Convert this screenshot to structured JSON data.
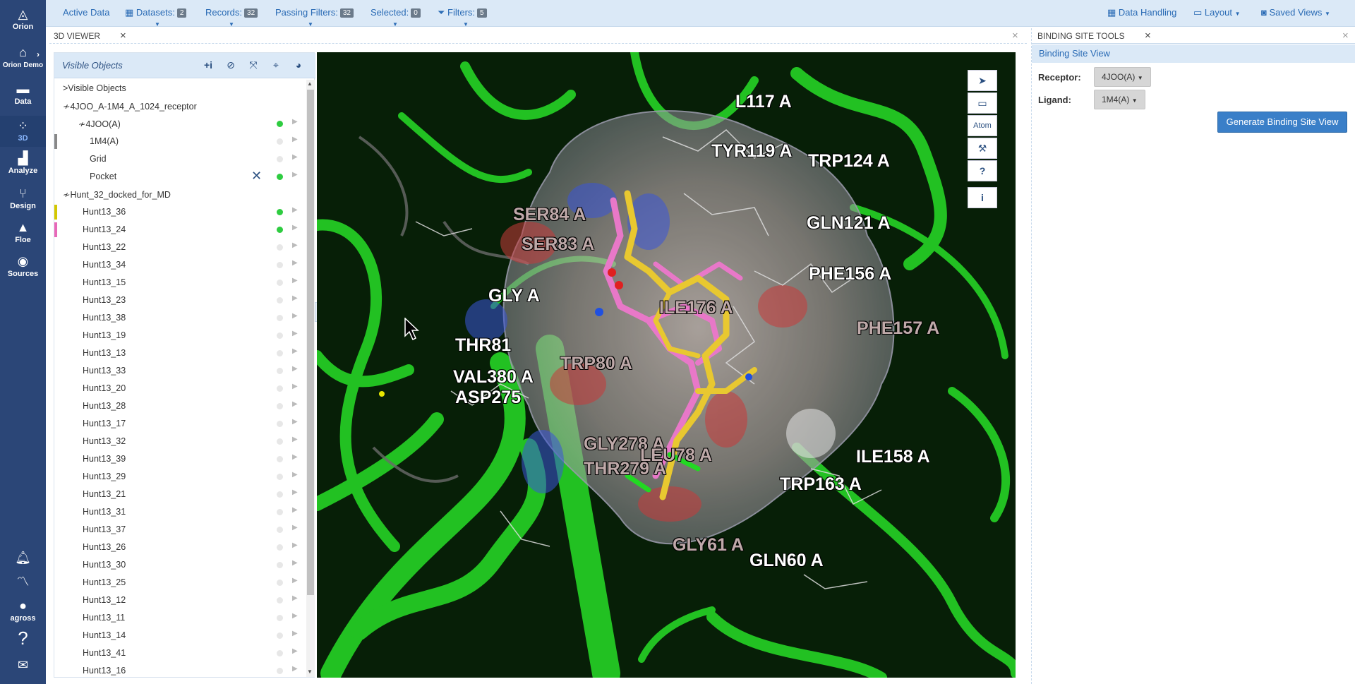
{
  "nav": {
    "brand": "Orion",
    "items": [
      {
        "label": "Orion Demo",
        "icon": "home-icon"
      },
      {
        "label": "Data",
        "icon": "folder-icon"
      },
      {
        "label": "3D",
        "icon": "molecule-icon"
      },
      {
        "label": "Analyze",
        "icon": "bar-chart-icon"
      },
      {
        "label": "Design",
        "icon": "flow-icon"
      },
      {
        "label": "Floe",
        "icon": "rocket-icon"
      },
      {
        "label": "Sources",
        "icon": "database-icon"
      }
    ],
    "user": "agross"
  },
  "topbar": {
    "active_data": "Active Data",
    "datasets": {
      "label": "Datasets:",
      "count": "2"
    },
    "records": {
      "label": "Records:",
      "count": "32"
    },
    "passing_filters": {
      "label": "Passing Filters:",
      "count": "32"
    },
    "selected": {
      "label": "Selected:",
      "count": "0"
    },
    "filters": {
      "label": "Filters:",
      "count": "5"
    },
    "data_handling": "Data Handling",
    "layout": "Layout",
    "saved_views": "Saved Views"
  },
  "viewer": {
    "tab_title": "3D VIEWER",
    "tree_title": "Visible Objects",
    "rows": [
      {
        "label": ">Visible Objects",
        "indent": 0,
        "dot": "",
        "color": ""
      },
      {
        "label": "≁4JOO_A-1M4_A_1024_receptor",
        "indent": 0,
        "dot": "",
        "color": ""
      },
      {
        "label": "≁4JOO(A)",
        "indent": 1,
        "dot": "on",
        "color": ""
      },
      {
        "label": "1M4(A)",
        "indent": 2,
        "dot": "off",
        "color": "#888888"
      },
      {
        "label": "Grid",
        "indent": 2,
        "dot": "off",
        "color": ""
      },
      {
        "label": "Pocket",
        "indent": 2,
        "dot": "on",
        "color": "",
        "x": true
      },
      {
        "label": "≁Hunt_32_docked_for_MD",
        "indent": 0,
        "dot": "",
        "color": ""
      },
      {
        "label": "Hunt13_36",
        "indent": 1,
        "dot": "on",
        "color": "#d4c800"
      },
      {
        "label": "Hunt13_24",
        "indent": 1,
        "dot": "on",
        "color": "#e868b8"
      },
      {
        "label": "Hunt13_22",
        "indent": 1,
        "dot": "off",
        "color": ""
      },
      {
        "label": "Hunt13_34",
        "indent": 1,
        "dot": "off",
        "color": ""
      },
      {
        "label": "Hunt13_15",
        "indent": 1,
        "dot": "off",
        "color": ""
      },
      {
        "label": "Hunt13_23",
        "indent": 1,
        "dot": "off",
        "color": ""
      },
      {
        "label": "Hunt13_38",
        "indent": 1,
        "dot": "off",
        "color": ""
      },
      {
        "label": "Hunt13_19",
        "indent": 1,
        "dot": "off",
        "color": ""
      },
      {
        "label": "Hunt13_13",
        "indent": 1,
        "dot": "off",
        "color": ""
      },
      {
        "label": "Hunt13_33",
        "indent": 1,
        "dot": "off",
        "color": ""
      },
      {
        "label": "Hunt13_20",
        "indent": 1,
        "dot": "off",
        "color": ""
      },
      {
        "label": "Hunt13_28",
        "indent": 1,
        "dot": "off",
        "color": ""
      },
      {
        "label": "Hunt13_17",
        "indent": 1,
        "dot": "off",
        "color": ""
      },
      {
        "label": "Hunt13_32",
        "indent": 1,
        "dot": "off",
        "color": ""
      },
      {
        "label": "Hunt13_39",
        "indent": 1,
        "dot": "off",
        "color": ""
      },
      {
        "label": "Hunt13_29",
        "indent": 1,
        "dot": "off",
        "color": ""
      },
      {
        "label": "Hunt13_21",
        "indent": 1,
        "dot": "off",
        "color": ""
      },
      {
        "label": "Hunt13_31",
        "indent": 1,
        "dot": "off",
        "color": ""
      },
      {
        "label": "Hunt13_37",
        "indent": 1,
        "dot": "off",
        "color": ""
      },
      {
        "label": "Hunt13_26",
        "indent": 1,
        "dot": "off",
        "color": ""
      },
      {
        "label": "Hunt13_30",
        "indent": 1,
        "dot": "off",
        "color": ""
      },
      {
        "label": "Hunt13_25",
        "indent": 1,
        "dot": "off",
        "color": ""
      },
      {
        "label": "Hunt13_12",
        "indent": 1,
        "dot": "off",
        "color": ""
      },
      {
        "label": "Hunt13_11",
        "indent": 1,
        "dot": "off",
        "color": ""
      },
      {
        "label": "Hunt13_14",
        "indent": 1,
        "dot": "off",
        "color": ""
      },
      {
        "label": "Hunt13_41",
        "indent": 1,
        "dot": "off",
        "color": ""
      },
      {
        "label": "Hunt13_16",
        "indent": 1,
        "dot": "off",
        "color": ""
      }
    ],
    "residue_labels": [
      {
        "text": "L117 A",
        "faded": false
      },
      {
        "text": "TYR119 A",
        "faded": false
      },
      {
        "text": "TRP124 A",
        "faded": false
      },
      {
        "text": "SER84 A",
        "faded": true
      },
      {
        "text": "SER83 A",
        "faded": true
      },
      {
        "text": "GLN121 A",
        "faded": false
      },
      {
        "text": "PHE156 A",
        "faded": false
      },
      {
        "text": "GLY A",
        "faded": false
      },
      {
        "text": "ILE176 A",
        "faded": true
      },
      {
        "text": "PHE157 A",
        "faded": true
      },
      {
        "text": "THR81",
        "faded": false
      },
      {
        "text": "TRP80 A",
        "faded": true
      },
      {
        "text": "VAL380 A",
        "faded": false
      },
      {
        "text": "ASP275",
        "faded": false
      },
      {
        "text": "GLY278 A",
        "faded": true
      },
      {
        "text": "LEU78 A",
        "faded": true
      },
      {
        "text": "THR279 A",
        "faded": true
      },
      {
        "text": "ILE158 A",
        "faded": false
      },
      {
        "text": "TRP163 A",
        "faded": false
      },
      {
        "text": "GLY61 A",
        "faded": true
      },
      {
        "text": "GLN60 A",
        "faded": false
      }
    ],
    "tools": [
      "➤",
      "▭",
      "Atom",
      "⚒",
      "?",
      "i"
    ]
  },
  "binding_site": {
    "tab_title": "BINDING SITE TOOLS",
    "view_title": "Binding Site View",
    "receptor_label": "Receptor:",
    "receptor_value": "4JOO(A)",
    "ligand_label": "Ligand:",
    "ligand_value": "1M4(A)",
    "generate_label": "Generate Binding Site View"
  },
  "colors": {
    "nav_bg": "#2b4677",
    "accent": "#2a6bb5",
    "ribbon": "#22c122",
    "ligand_yellow": "#e8c830",
    "ligand_pink": "#e878c8"
  }
}
